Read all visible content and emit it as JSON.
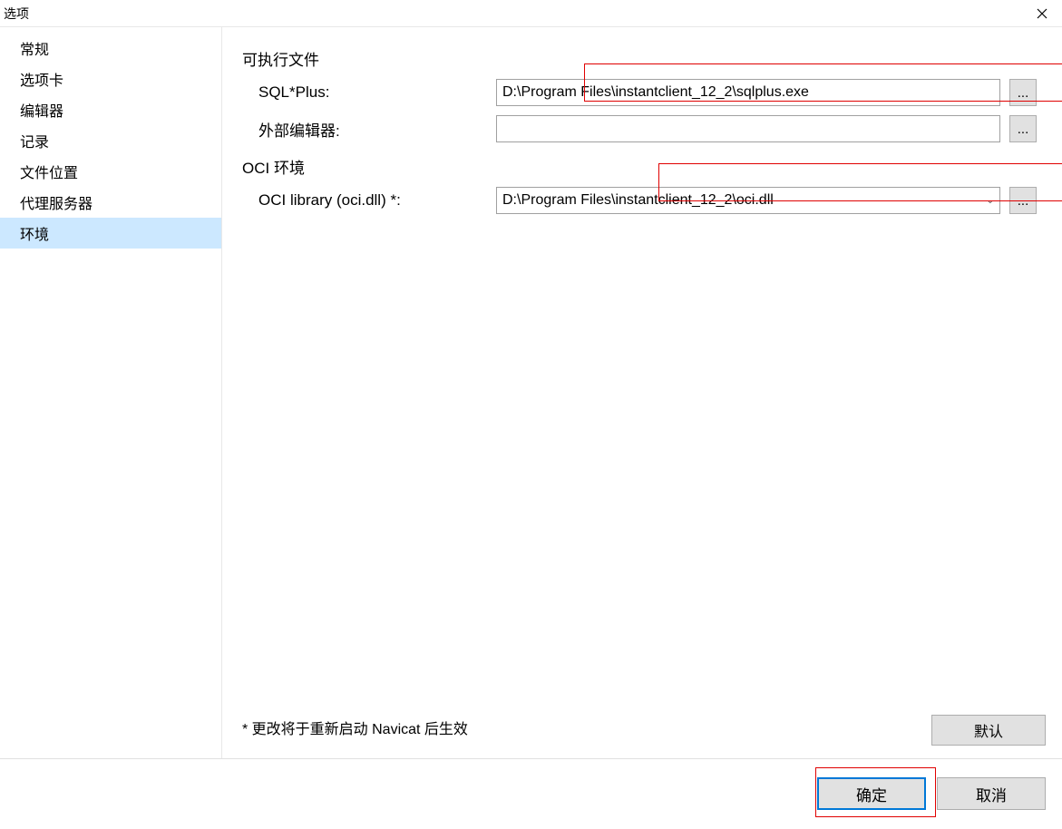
{
  "window": {
    "title": "选项"
  },
  "sidebar": {
    "items": [
      {
        "label": "常规"
      },
      {
        "label": "选项卡"
      },
      {
        "label": "编辑器"
      },
      {
        "label": "记录"
      },
      {
        "label": "文件位置"
      },
      {
        "label": "代理服务器"
      },
      {
        "label": "环境"
      }
    ],
    "selectedIndex": 6
  },
  "content": {
    "section_executables": "可执行文件",
    "sqlplus_label": "SQL*Plus:",
    "sqlplus_value": "D:\\Program Files\\instantclient_12_2\\sqlplus.exe",
    "external_editor_label": "外部编辑器:",
    "external_editor_value": "",
    "section_oci": "OCI 环境",
    "oci_library_label": "OCI library (oci.dll) *:",
    "oci_library_value": "D:\\Program Files\\instantclient_12_2\\oci.dll",
    "browse_label": "...",
    "restart_note": "* 更改将于重新启动 Navicat 后生效",
    "defaults_label": "默认"
  },
  "footer": {
    "ok_label": "确定",
    "cancel_label": "取消"
  }
}
